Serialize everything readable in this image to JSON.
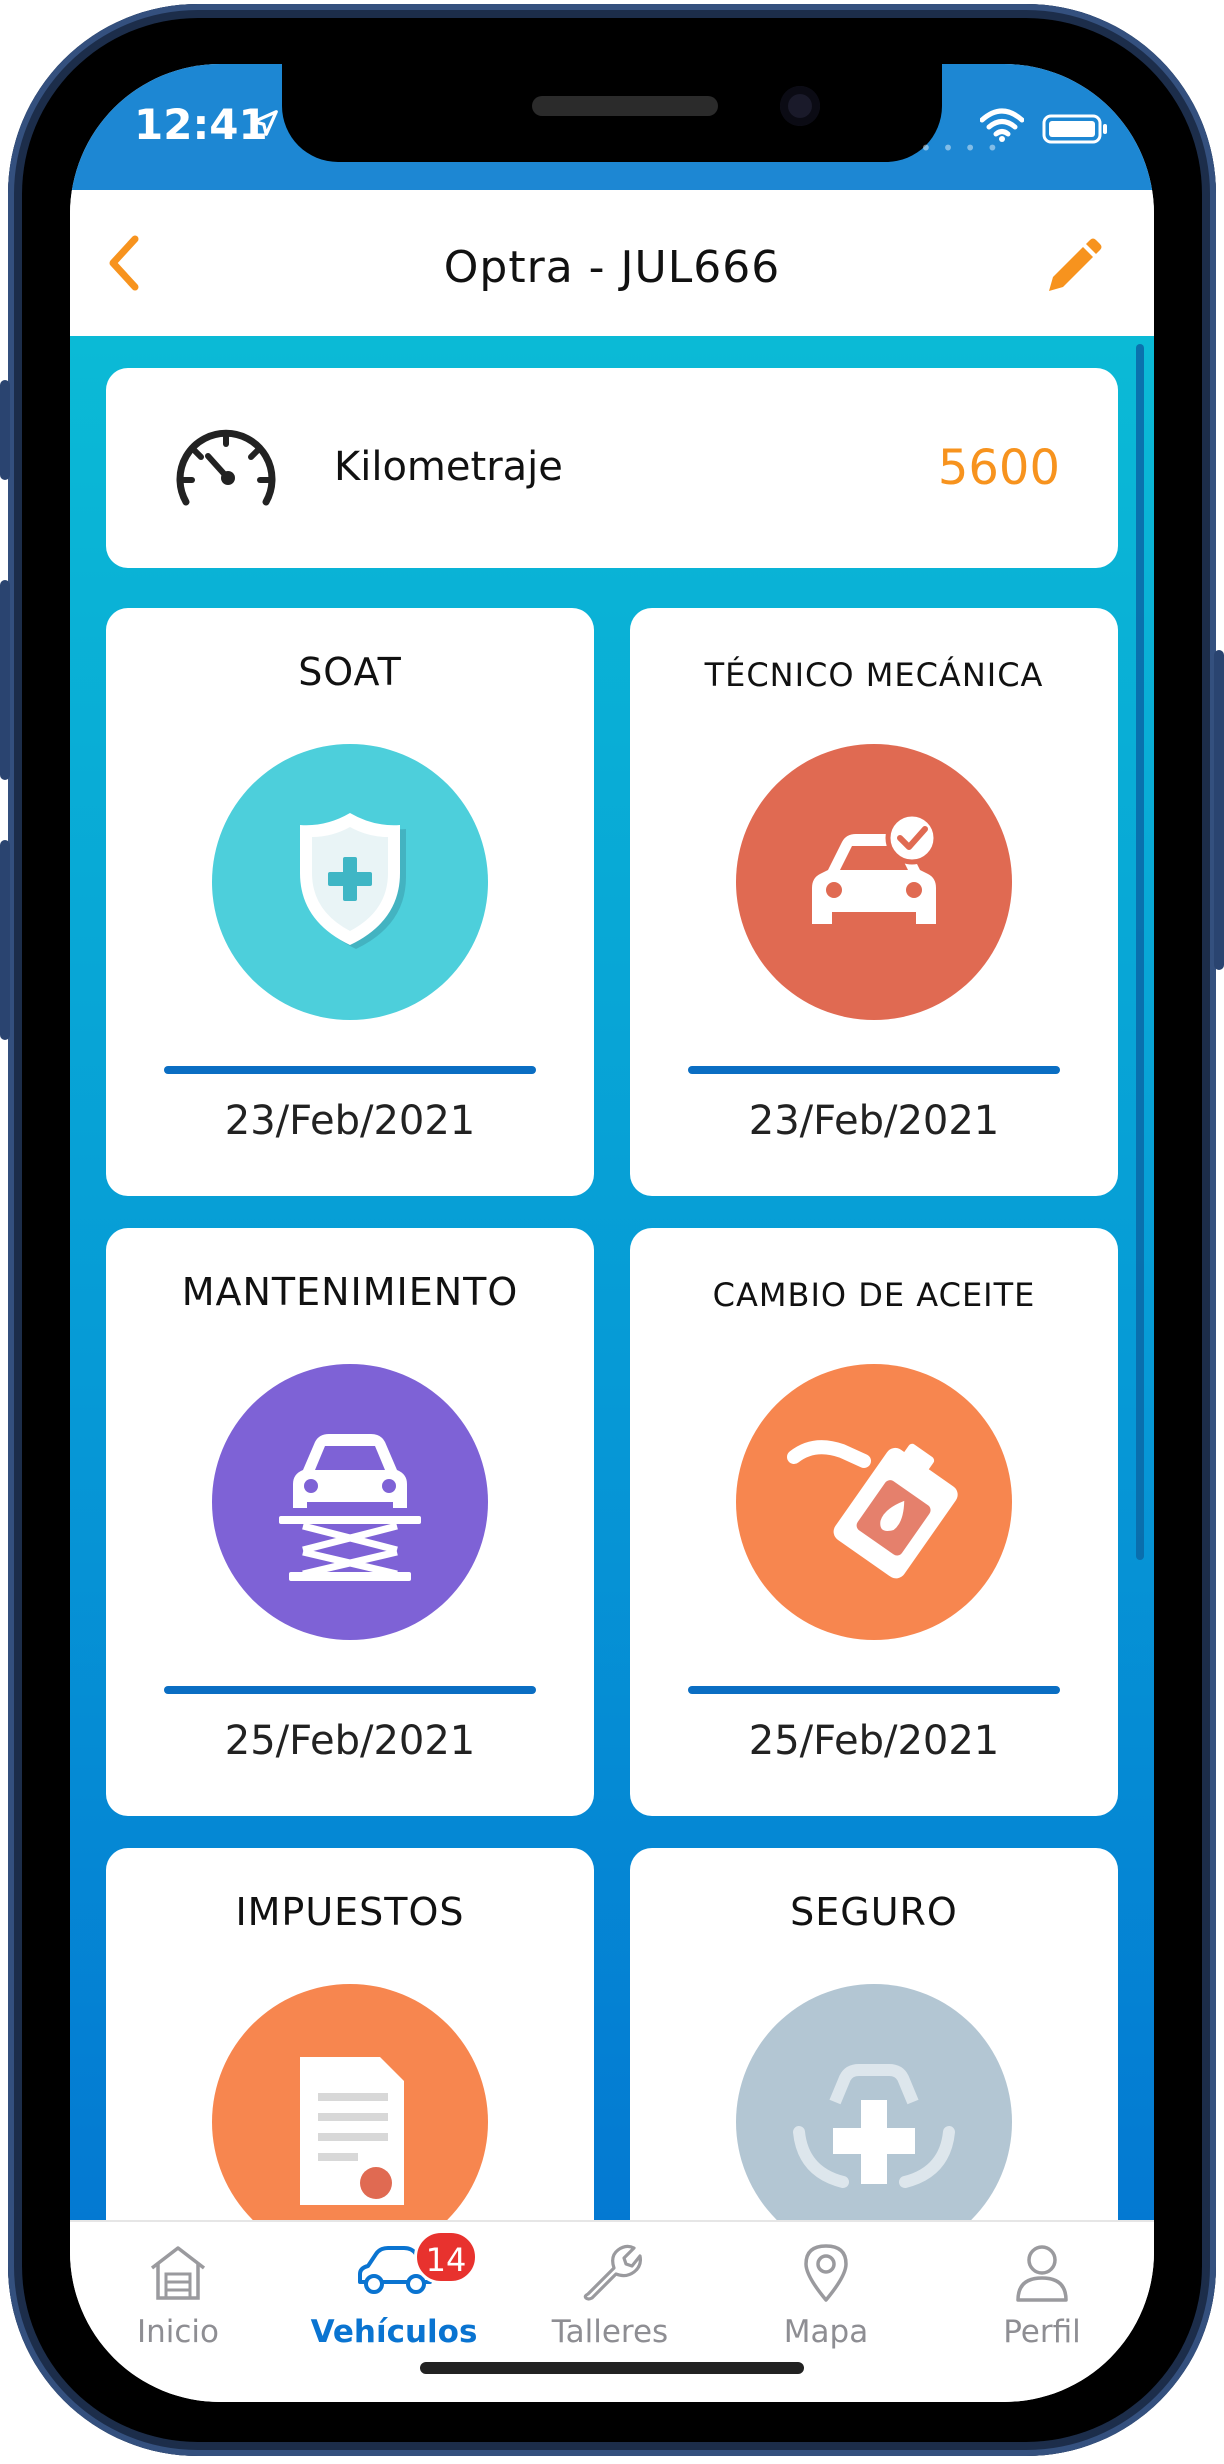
{
  "status_bar": {
    "time": "12:41",
    "location_icon": "location-arrow-icon",
    "wifi_icon": "wifi-icon",
    "battery_icon": "battery-icon",
    "color": "#1d87d3"
  },
  "nav": {
    "title": "Optra - JUL666",
    "back_icon": "chevron-left-icon",
    "edit_icon": "pencil-icon",
    "accent_color": "#f7931e"
  },
  "kilometraje": {
    "label": "Kilometraje",
    "value": "5600",
    "icon": "speedometer-icon"
  },
  "cards": [
    {
      "title": "SOAT",
      "date": "23/Feb/2021",
      "icon": "shield-plus-icon",
      "color": "#4dcfdb"
    },
    {
      "title": "TÉCNICO MECÁNICA",
      "date": "23/Feb/2021",
      "icon": "car-check-icon",
      "color": "#e06a52"
    },
    {
      "title": "MANTENIMIENTO",
      "date": "25/Feb/2021",
      "icon": "car-lift-icon",
      "color": "#7e62d6"
    },
    {
      "title": "CAMBIO DE ACEITE",
      "date": "25/Feb/2021",
      "icon": "oil-can-icon",
      "color": "#f7864f"
    },
    {
      "title": "IMPUESTOS",
      "date": "",
      "icon": "tax-document-icon",
      "color": "#f7864f"
    },
    {
      "title": "SEGURO",
      "date": "",
      "icon": "car-insurance-icon",
      "color": "#b3c6d3"
    }
  ],
  "tabs": [
    {
      "label": "Inicio",
      "icon": "garage-icon",
      "active": false
    },
    {
      "label": "Vehículos",
      "icon": "car-icon",
      "active": true,
      "badge": "14"
    },
    {
      "label": "Talleres",
      "icon": "wrench-icon",
      "active": false
    },
    {
      "label": "Mapa",
      "icon": "map-pin-icon",
      "active": false
    },
    {
      "label": "Perfil",
      "icon": "user-icon",
      "active": false
    }
  ],
  "colors": {
    "content_gradient_top": "#0bbad6",
    "content_gradient_bottom": "#0479d2",
    "active_tab": "#0a74d1",
    "badge": "#e8322e",
    "progress_bar": "#0a6ec3"
  }
}
